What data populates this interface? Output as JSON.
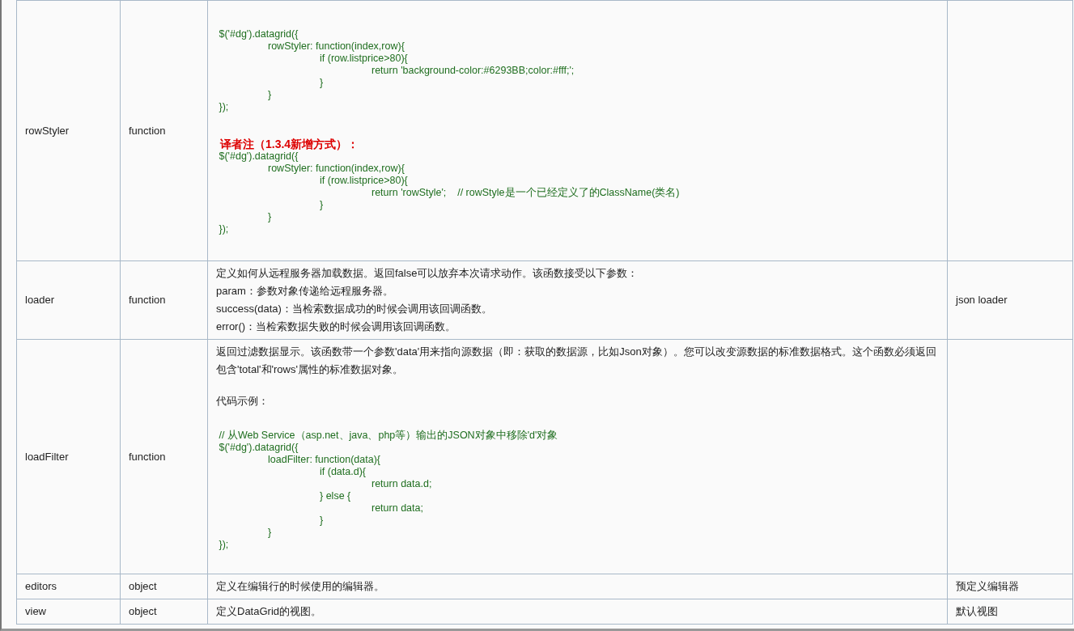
{
  "table": {
    "rows": [
      {
        "name": "rowStyler",
        "type": "function",
        "default": "",
        "description": [
          {
            "kind": "code",
            "lines": [
              " $('#dg').datagrid({",
              "\trowStyler: function(index,row){",
              "\t\tif (row.listprice>80){",
              "\t\t\treturn 'background-color:#6293BB;color:#fff;';",
              "\t\t}",
              "\t}",
              " });"
            ]
          },
          {
            "kind": "note",
            "text": "译者注（1.3.4新增方式）："
          },
          {
            "kind": "code",
            "lines": [
              " $('#dg').datagrid({",
              "\trowStyler: function(index,row){",
              "\t\tif (row.listprice>80){",
              "\t\t\treturn 'rowStyle';    // rowStyle是一个已经定义了的ClassName(类名)",
              "\t\t}",
              "\t}",
              " });"
            ]
          }
        ]
      },
      {
        "name": "loader",
        "type": "function",
        "default": "json loader",
        "description": [
          {
            "kind": "text",
            "text": "定义如何从远程服务器加载数据。返回false可以放弃本次请求动作。该函数接受以下参数："
          },
          {
            "kind": "text",
            "text": "param：参数对象传递给远程服务器。"
          },
          {
            "kind": "text",
            "text": "success(data)：当检索数据成功的时候会调用该回调函数。"
          },
          {
            "kind": "text",
            "text": "error()：当检索数据失败的时候会调用该回调函数。"
          }
        ]
      },
      {
        "name": "loadFilter",
        "type": "function",
        "default": "",
        "description": [
          {
            "kind": "text",
            "text": "返回过滤数据显示。该函数带一个参数'data'用来指向源数据（即：获取的数据源，比如Json对象）。您可以改变源数据的标准数据格式。这个函数必须返回包含'total'和'rows'属性的标准数据对象。"
          },
          {
            "kind": "text",
            "text": "代码示例："
          },
          {
            "kind": "code",
            "lines": [
              " // 从Web Service（asp.net、java、php等）输出的JSON对象中移除'd'对象",
              " $('#dg').datagrid({",
              "\tloadFilter: function(data){",
              "\t\tif (data.d){",
              "\t\t\treturn data.d;",
              "\t\t} else {",
              "\t\t\treturn data;",
              "\t\t}",
              "\t}",
              " });"
            ]
          }
        ]
      },
      {
        "name": "editors",
        "type": "object",
        "default": "预定义编辑器",
        "description": [
          {
            "kind": "text",
            "text": "定义在编辑行的时候使用的编辑器。"
          }
        ]
      },
      {
        "name": "view",
        "type": "object",
        "default": "默认视图",
        "description": [
          {
            "kind": "text",
            "text": "定义DataGrid的视图。"
          }
        ]
      }
    ]
  }
}
